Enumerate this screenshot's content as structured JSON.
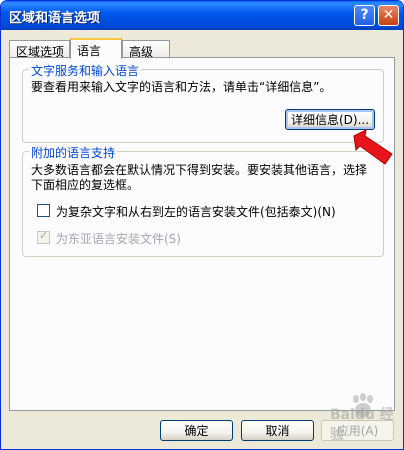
{
  "window": {
    "title": "区域和语言选项",
    "help_glyph": "?",
    "close_glyph": "✕"
  },
  "tabs": [
    {
      "label": "区域选项",
      "active": false
    },
    {
      "label": "语言",
      "active": true
    },
    {
      "label": "高级",
      "active": false
    }
  ],
  "text_services": {
    "legend": "文字服务和输入语言",
    "description": "要查看用来输入文字的语言和方法，请单击“详细信息”。",
    "details_button": "详细信息(D)..."
  },
  "supplemental": {
    "legend": "附加的语言支持",
    "description_line1": "大多数语言都会在默认情况下得到安装。要安装其他语言，选择",
    "description_line2": "下面相应的复选框。",
    "checkbox_complex": {
      "label": "为复杂文字和从右到左的语言安装文件(包括泰文)(N)",
      "checked": false,
      "enabled": true
    },
    "checkbox_east_asian": {
      "label": "为东亚语言安装文件(S)",
      "checked": true,
      "enabled": false
    }
  },
  "footer": {
    "ok": "确定",
    "cancel": "取消",
    "apply": "应用(A)"
  },
  "watermark": "Baidu 经验",
  "colors": {
    "titlebar": "#0058EE",
    "dialog_bg": "#ECE9D8",
    "group_legend": "#0046D5",
    "annotation_arrow": "#E8141B"
  }
}
